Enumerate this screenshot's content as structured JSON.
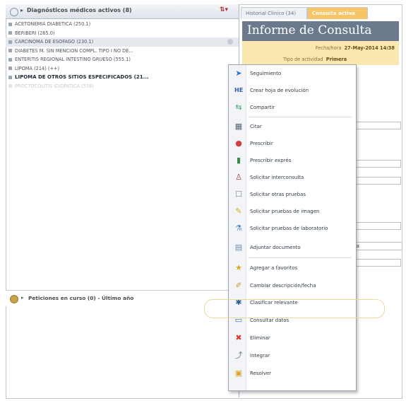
{
  "left_panel": {
    "header_title": "Diagnósticos médicos activos (8)",
    "diagnoses": [
      {
        "label": "ACETONEMIA DIABETICA (250.1)",
        "style": "normal"
      },
      {
        "label": "BERIBERI (265.0)",
        "style": "normal"
      },
      {
        "label": "CARCINOMA DE ESOFAGO (230.1)",
        "style": "selected"
      },
      {
        "label": "DIABETES M. SIN MENCION COMPL. TIPO I NO DE...",
        "style": "normal"
      },
      {
        "label": "ENTERITIS REGIONAL INTESTINO GRUESO (555.1)",
        "style": "normal"
      },
      {
        "label": "LIPOMA (214) (++)",
        "style": "normal"
      },
      {
        "label": "LIPOMA DE OTROS SITIOS ESPECIFICADOS (21...",
        "style": "bold"
      },
      {
        "label": "PROCTOCOLITIS IDIOPATICA (556)",
        "style": "faded"
      }
    ],
    "petitions_title": "Peticiones en curso (0) - Último año"
  },
  "right_panel": {
    "tabs": [
      {
        "label": "Historial Clínico (34)",
        "active": false
      },
      {
        "label": "Consulta activa",
        "active": true
      }
    ],
    "title": "Informe de Consulta",
    "date_label": "Fecha/hora",
    "date_value": "27-May-2014 14:38",
    "activity_label": "Tipo de actividad",
    "activity_value": "Primera",
    "field_value": "nera"
  },
  "context_menu": {
    "items": [
      {
        "label": "Seguimiento",
        "icon": "arrow-right-icon"
      },
      {
        "label": "Crear hoja de evolución",
        "icon": "sheet-icon"
      },
      {
        "label": "Compartir",
        "icon": "share-icon"
      },
      {
        "label": "Citar",
        "icon": "calendar-icon"
      },
      {
        "label": "Prescribir",
        "icon": "pills-icon"
      },
      {
        "label": "Prescribir exprés",
        "icon": "bottle-icon"
      },
      {
        "label": "Solicitar interconsulta",
        "icon": "doctor-icon"
      },
      {
        "label": "Solicitar otras pruebas",
        "icon": "tests-icon"
      },
      {
        "label": "Solicitar pruebas de imagen",
        "icon": "image-icon"
      },
      {
        "label": "Solicitar pruebas de laboratorio",
        "icon": "lab-icon"
      },
      {
        "label": "Adjuntar documento",
        "icon": "document-icon"
      },
      {
        "label": "Agregar a favoritos",
        "icon": "star-icon"
      },
      {
        "label": "Cambiar descripción/fecha",
        "icon": "edit-icon"
      },
      {
        "label": "Clasificar relevante",
        "icon": "pin-icon"
      },
      {
        "label": "Consultar datos",
        "icon": "monitor-icon"
      },
      {
        "label": "Eliminar",
        "icon": "delete-icon"
      },
      {
        "label": "Integrar",
        "icon": "integrate-icon"
      },
      {
        "label": "Resolver",
        "icon": "resolve-icon"
      }
    ]
  },
  "colors": {
    "accent_tab": "#f6c568",
    "title_bar": "#6b7a8d",
    "info_background": "#fbe7b0",
    "highlight_ring": "#ead89a"
  }
}
